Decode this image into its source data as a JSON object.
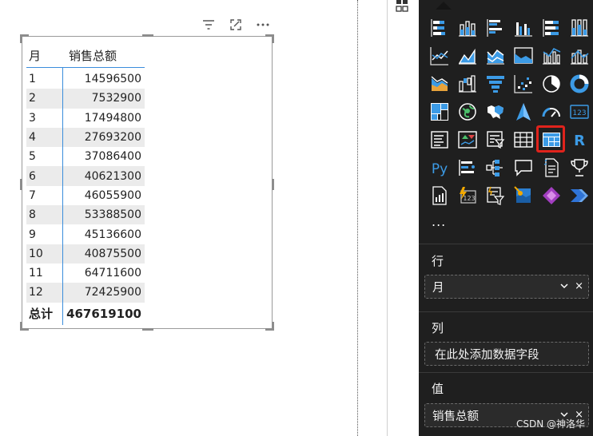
{
  "toolbar": {
    "filter_icon": "filter-icon",
    "focus_icon": "focus-mode-icon",
    "more_icon": "more-options-icon"
  },
  "table": {
    "headers": [
      "月",
      "销售总额"
    ],
    "rows": [
      [
        "1",
        "14596500"
      ],
      [
        "2",
        "7532900"
      ],
      [
        "3",
        "17494800"
      ],
      [
        "4",
        "27693200"
      ],
      [
        "5",
        "37086400"
      ],
      [
        "6",
        "40621300"
      ],
      [
        "7",
        "46055900"
      ],
      [
        "8",
        "53388500"
      ],
      [
        "9",
        "45136600"
      ],
      [
        "10",
        "40875500"
      ],
      [
        "11",
        "64711600"
      ],
      [
        "12",
        "72425900"
      ]
    ],
    "total": [
      "总计",
      "467619100"
    ]
  },
  "panel": {
    "more": "...",
    "rows_label": "行",
    "rows_field": "月",
    "columns_label": "列",
    "columns_placeholder": "在此处添加数据字段",
    "values_label": "值",
    "values_field": "销售总额",
    "remove_glyph": "×",
    "expand_glyph": "⌄"
  },
  "visuals": [
    "stacked-bar-icon",
    "stacked-column-icon",
    "clustered-bar-icon",
    "clustered-column-icon",
    "100-stacked-bar-icon",
    "100-stacked-column-icon",
    "line-chart-icon",
    "area-chart-icon",
    "stacked-area-icon",
    "ribbon-chart-icon",
    "line-clustered-column-icon",
    "line-stacked-column-icon",
    "ribbon-icon",
    "waterfall-icon",
    "funnel-icon",
    "scatter-icon",
    "pie-chart-icon",
    "donut-chart-icon",
    "treemap-icon",
    "map-icon",
    "filled-map-icon",
    "azure-map-icon",
    "gauge-icon",
    "card-icon",
    "multi-row-card-icon",
    "kpi-icon",
    "slicer-icon",
    "table-icon",
    "matrix-icon",
    "r-visual-icon",
    "python-visual-icon",
    "key-influencers-icon",
    "decomposition-tree-icon",
    "qa-icon",
    "narrative-icon",
    "goals-icon",
    "paginated-report-icon",
    "power-apps-icon",
    "smart-narrative-icon",
    "arcgis-icon",
    "power-apps-diamond-icon",
    "power-automate-icon"
  ],
  "selected_visual": "matrix-icon",
  "watermark": "CSDN @神洛华",
  "colors": {
    "panel_bg": "#1f1f1f",
    "accent_blue": "#3b8ddc",
    "selection_red": "#e0231c",
    "alt_row": "#ebebeb"
  }
}
